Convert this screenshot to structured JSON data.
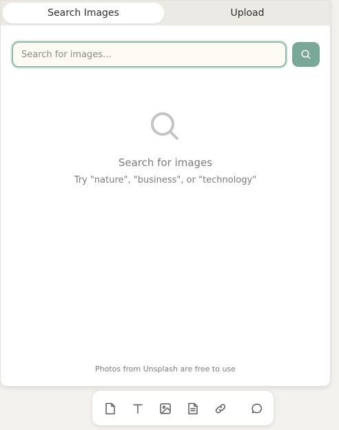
{
  "tabs": [
    {
      "label": "Search Images",
      "active": true
    },
    {
      "label": "Upload",
      "active": false
    }
  ],
  "search": {
    "placeholder": "Search for images...",
    "value": ""
  },
  "empty_state": {
    "title": "Search for images",
    "subtitle": "Try \"nature\", \"business\", or \"technology\""
  },
  "footer_note": "Photos from Unsplash are free to use",
  "toolbar": {
    "tools": [
      "page-icon",
      "text-icon",
      "image-icon",
      "document-icon",
      "link-icon",
      "comment-icon"
    ]
  },
  "colors": {
    "accent": "#79a898",
    "input_border": "#8fb9a8",
    "background": "#f4f2ee"
  }
}
